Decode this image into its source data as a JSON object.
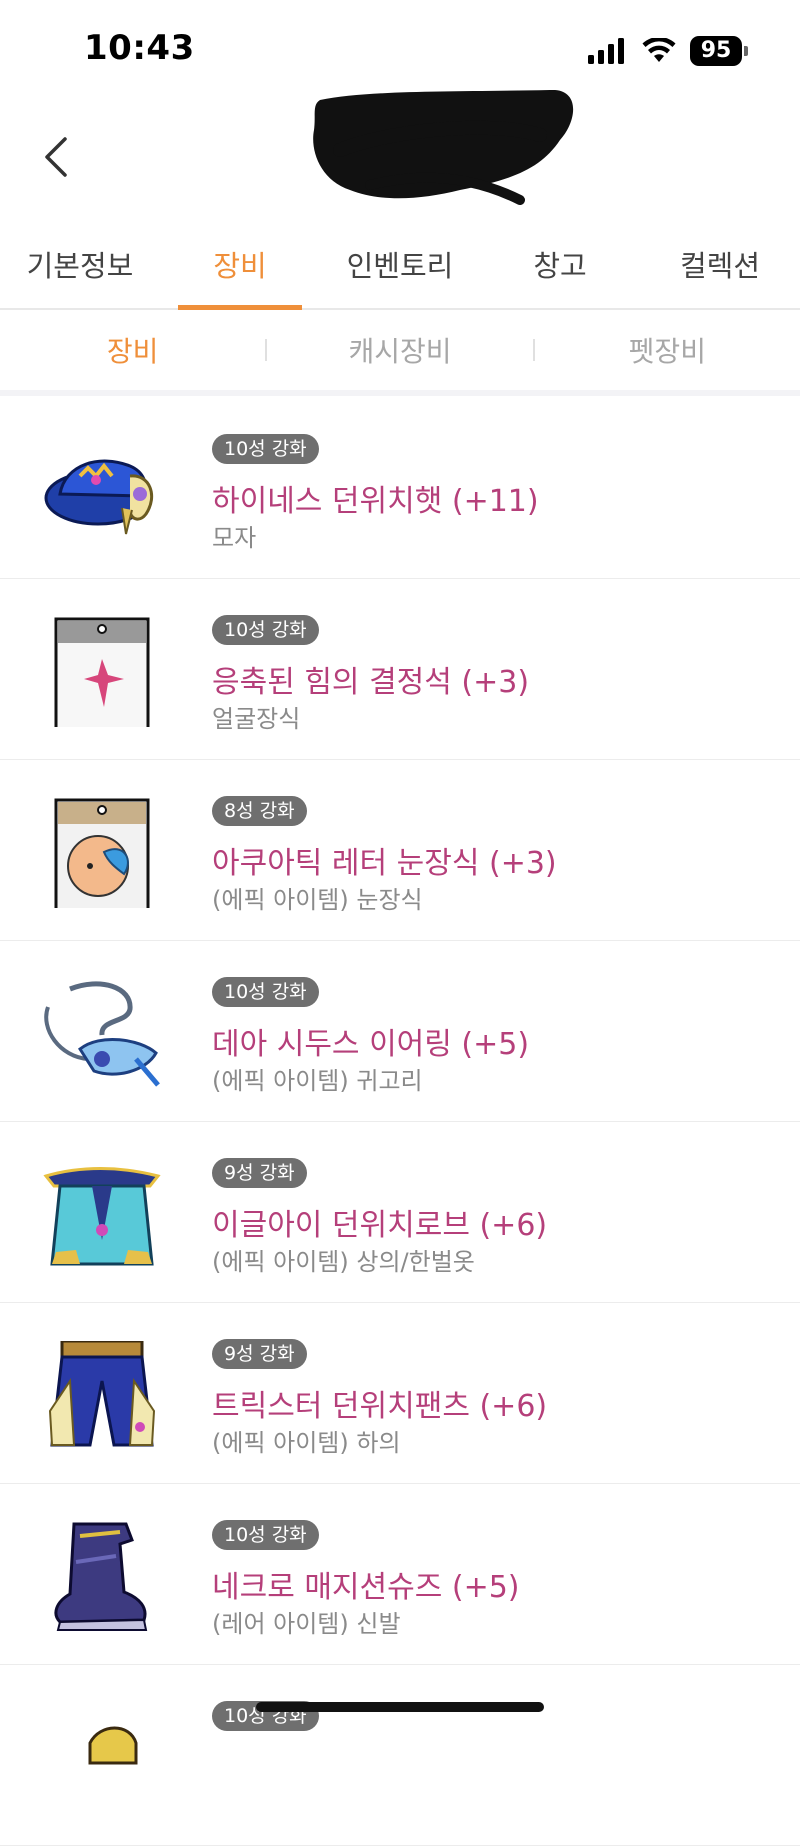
{
  "status_bar": {
    "time": "10:43",
    "battery": "95"
  },
  "tabs": [
    {
      "label": "기본정보",
      "active": false
    },
    {
      "label": "장비",
      "active": true
    },
    {
      "label": "인벤토리",
      "active": false
    },
    {
      "label": "창고",
      "active": false
    },
    {
      "label": "컬렉션",
      "active": false
    }
  ],
  "subtabs": [
    {
      "label": "장비",
      "active": true
    },
    {
      "label": "캐시장비",
      "active": false
    },
    {
      "label": "펫장비",
      "active": false
    }
  ],
  "items": [
    {
      "badge": "10성 강화",
      "name": "하이네스 던위치햇 (+11)",
      "type": "모자",
      "icon": "hat-icon"
    },
    {
      "badge": "10성 강화",
      "name": "응축된 힘의 결정석 (+3)",
      "type": "얼굴장식",
      "icon": "face-accessory-icon"
    },
    {
      "badge": "8성 강화",
      "name": "아쿠아틱 레터 눈장식 (+3)",
      "type": "(에픽 아이템) 눈장식",
      "icon": "eye-accessory-icon"
    },
    {
      "badge": "10성 강화",
      "name": "데아 시두스 이어링 (+5)",
      "type": "(에픽 아이템) 귀고리",
      "icon": "earring-icon"
    },
    {
      "badge": "9성 강화",
      "name": "이글아이 던위치로브 (+6)",
      "type": "(에픽 아이템) 상의/한벌옷",
      "icon": "robe-icon"
    },
    {
      "badge": "9성 강화",
      "name": "트릭스터 던위치팬츠 (+6)",
      "type": "(에픽 아이템) 하의",
      "icon": "pants-icon"
    },
    {
      "badge": "10성 강화",
      "name": "네크로 매지션슈즈 (+5)",
      "type": "(레어 아이템) 신발",
      "icon": "shoes-icon"
    },
    {
      "badge": "10성 강화",
      "name": "",
      "type": "",
      "icon": "item-icon"
    }
  ],
  "colors": {
    "accent": "#ef8f3a",
    "item_name": "#b53f7a",
    "badge_bg": "#6f6f6f"
  }
}
